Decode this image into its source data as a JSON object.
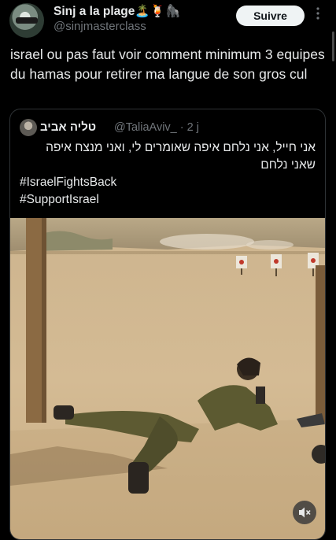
{
  "author": {
    "display_name": "Sinj a la plage",
    "name_emojis": "🏝️🍹🦍",
    "handle": "@sinjmasterclass",
    "follow_label": "Suivre"
  },
  "tweet": {
    "text": "israel ou pas faut voir comment minimum 3 equipes du hamas pour retirer ma langue de son gros cul"
  },
  "quoted": {
    "display_name": "טליה אביב",
    "handle": "@TaliaAviv_",
    "time": "· 2 j",
    "body": "אני חייל, אני נלחם איפה שאומרים לי, ואני מנצח איפה שאני נלחם",
    "hashtag_1": "#IsraelFightsBack",
    "hashtag_2": "#SupportIsrael"
  },
  "icons": {
    "more": "more-icon",
    "mute": "speaker-muted-icon"
  }
}
